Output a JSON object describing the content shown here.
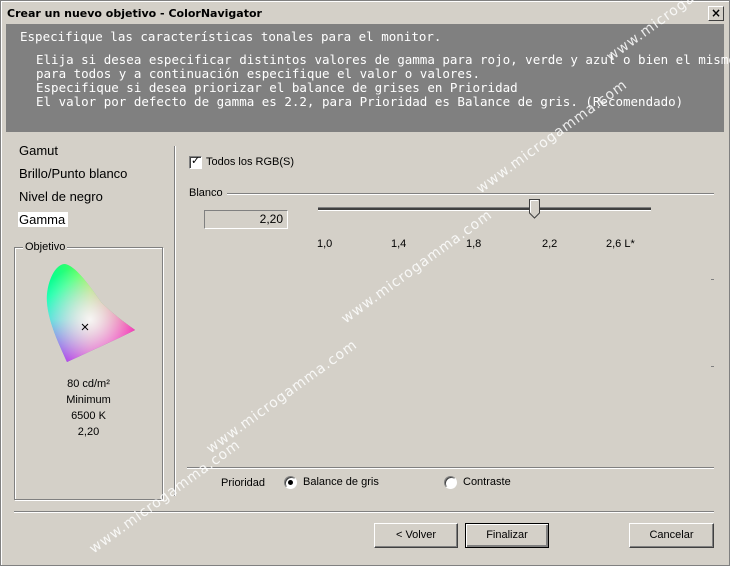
{
  "window": {
    "title": "Crear un nuevo objetivo - ColorNavigator",
    "close_glyph": "×"
  },
  "header": {
    "title": "Especifique las características tonales para el monitor.",
    "lines": [
      "Elija si desea especificar distintos valores de gamma para rojo, verde y azul o bien el mismo",
      "para todos y a continuación especifique el valor o valores.",
      "Especifique si desea priorizar el balance de grises en Prioridad",
      "El valor por defecto de gamma es 2.2, para Prioridad es Balance de gris. (Recomendado)"
    ]
  },
  "nav": {
    "items": [
      {
        "label": "Gamut",
        "selected": false
      },
      {
        "label": "Brillo/Punto blanco",
        "selected": false
      },
      {
        "label": "Nivel de negro",
        "selected": false
      },
      {
        "label": "Gamma",
        "selected": true
      }
    ]
  },
  "objetivo": {
    "label": "Objetivo",
    "luminance": "80 cd/m²",
    "black_level": "Minimum",
    "white_point": "6500 K",
    "gamma": "2,20"
  },
  "gamma": {
    "all_rgb_label": "Todos los RGB(S)",
    "all_rgb_checked": true,
    "channel_label": "Blanco",
    "value": "2,20",
    "slider_value": 2.2,
    "slider_min": 0.9,
    "slider_max": 2.9,
    "ticks": [
      "1,0",
      "1,4",
      "1,8",
      "2,2",
      "2,6 L*"
    ]
  },
  "priority": {
    "label": "Prioridad",
    "options": [
      {
        "label": "Balance de gris",
        "selected": true
      },
      {
        "label": "Contraste",
        "selected": false
      }
    ]
  },
  "buttons": {
    "back": "< Volver",
    "finish": "Finalizar",
    "cancel": "Cancelar"
  },
  "watermark": "www.microgamma.com",
  "colors": {
    "header_bg": "#808080",
    "window_bg": "#d4d0c8"
  }
}
